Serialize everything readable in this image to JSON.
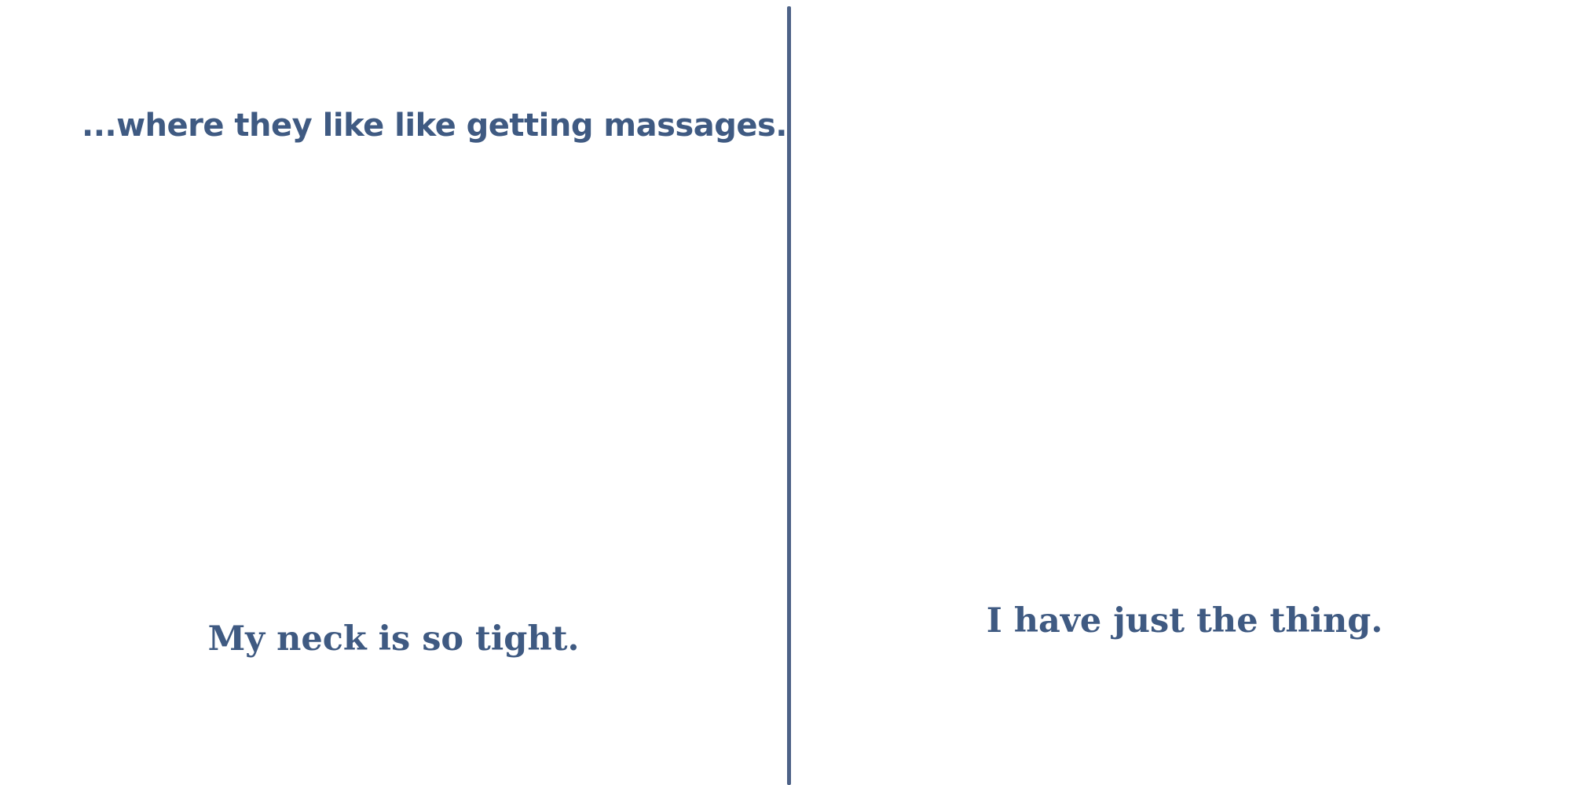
{
  "panels": [
    {
      "narration": "...where they like like getting massages.",
      "dialogue": "My neck is so tight."
    },
    {
      "dialogue": "I have just the thing."
    }
  ],
  "colors": {
    "text": "#3f5a82",
    "divider": "#4d6287",
    "background": "#ffffff"
  }
}
